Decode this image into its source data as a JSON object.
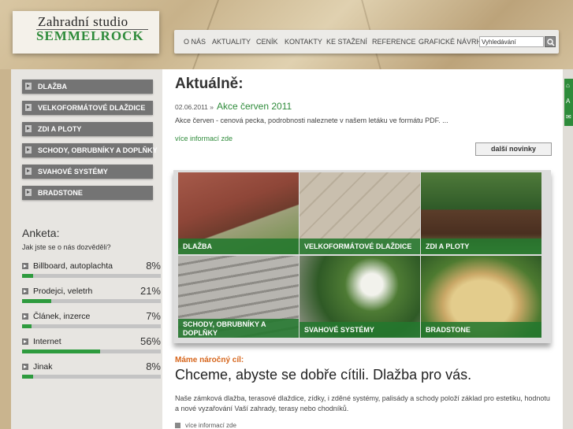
{
  "header": {
    "logo_line1": "Zahradní studio",
    "logo_line2": "SEMMELROCK",
    "nav": [
      "O NÁS",
      "AKTUALITY",
      "CENÍK",
      "KONTAKTY",
      "KE STAŽENÍ",
      "REFERENCE",
      "GRAFICKÉ NÁVRHY"
    ],
    "search_value": "Vyhledávání"
  },
  "sidebar": {
    "items": [
      {
        "label": "DLAŽBA"
      },
      {
        "label": "VELKOFORMÁTOVÉ DLAŽDICE"
      },
      {
        "label": "ZDI A PLOTY"
      },
      {
        "label": "SCHODY, OBRUBNÍKY A DOPLŇKY"
      },
      {
        "label": "SVAHOVÉ SYSTÉMY"
      },
      {
        "label": "BRADSTONE"
      }
    ]
  },
  "poll": {
    "title": "Anketa:",
    "question": "Jak jste se o nás dozvěděli?",
    "options": [
      {
        "label": "Billboard, autoplachta",
        "percent": "8%",
        "value": 8
      },
      {
        "label": "Prodejci, veletrh",
        "percent": "21%",
        "value": 21
      },
      {
        "label": "Článek, inzerce",
        "percent": "7%",
        "value": 7
      },
      {
        "label": "Internet",
        "percent": "56%",
        "value": 56
      },
      {
        "label": "Jinak",
        "percent": "8%",
        "value": 8
      }
    ]
  },
  "news": {
    "title": "Aktuálně:",
    "date": "02.06.2011 »",
    "headline": "Akce červen 2011",
    "text": "Akce červen - cenová pecka, podrobnosti naleznete v našem letáku ve formátu PDF.  ...",
    "more_link": "více informací zde",
    "more_news_button": "další novinky"
  },
  "tiles": [
    {
      "label": "DLAŽBA"
    },
    {
      "label": "VELKOFORMÁTOVÉ DLAŽDICE"
    },
    {
      "label": "ZDI A PLOTY"
    },
    {
      "label": "SCHODY, OBRUBNÍKY A DOPLŇKY"
    },
    {
      "label": "SVAHOVÉ SYSTÉMY"
    },
    {
      "label": "BRADSTONE"
    }
  ],
  "slogan": {
    "small": "Máme náročný cíl:",
    "big": "Chceme, abyste se dobře cítili. Dlažba pro vás.",
    "description": "Naše zámková dlažba, terasové dlaždice, zídky, i zděné systémy, palisády a schody položí základ pro estetiku, hodnotu a nové vyzařování Vaší zahrady, terasy nebo chodníků.",
    "more_link": "více informací zde"
  },
  "colors": {
    "accent_green": "#2e8b3a",
    "orange": "#d6651b",
    "menu_gray": "#747474"
  }
}
